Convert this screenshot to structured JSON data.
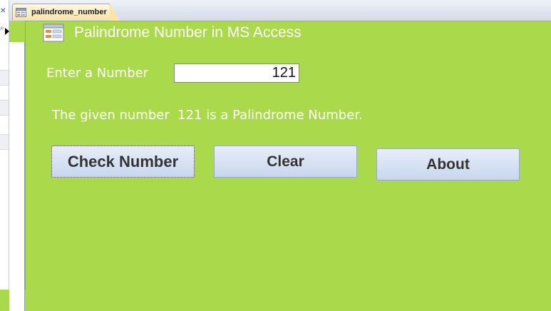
{
  "tab": {
    "label": "palindrome_number",
    "icon": "form-icon"
  },
  "form": {
    "title": "Palindrome Number in MS Access",
    "title_icon": "form-icon",
    "input_label": "Enter a Number",
    "input_value": "121",
    "result": "The given number  121 is a Palindrome Number."
  },
  "buttons": {
    "check": "Check Number",
    "clear": "Clear",
    "about": "About"
  },
  "colors": {
    "form_background": "#aad94c",
    "text": "#ffffff"
  }
}
